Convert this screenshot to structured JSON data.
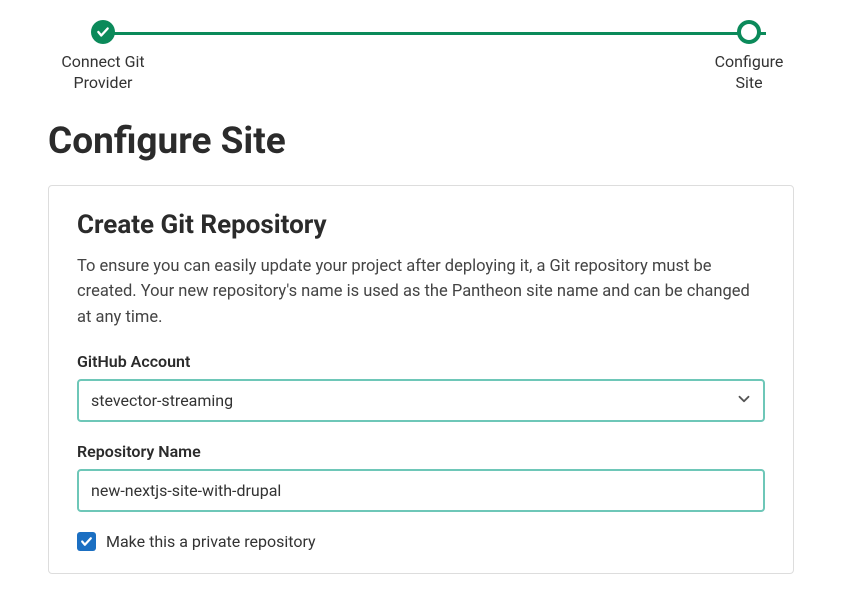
{
  "stepper": {
    "steps": [
      {
        "label": "Connect Git Provider",
        "state": "completed"
      },
      {
        "label": "Configure Site",
        "state": "current"
      }
    ]
  },
  "page": {
    "title": "Configure Site"
  },
  "card": {
    "title": "Create Git Repository",
    "description": "To ensure you can easily update your project after deploying it, a Git repository must be created. Your new repository's name is used as the Pantheon site name and can be changed at any time.",
    "fields": {
      "account": {
        "label": "GitHub Account",
        "value": "stevector-streaming"
      },
      "repo": {
        "label": "Repository Name",
        "value": "new-nextjs-site-with-drupal"
      },
      "private": {
        "label": "Make this a private repository",
        "checked": true
      }
    }
  }
}
